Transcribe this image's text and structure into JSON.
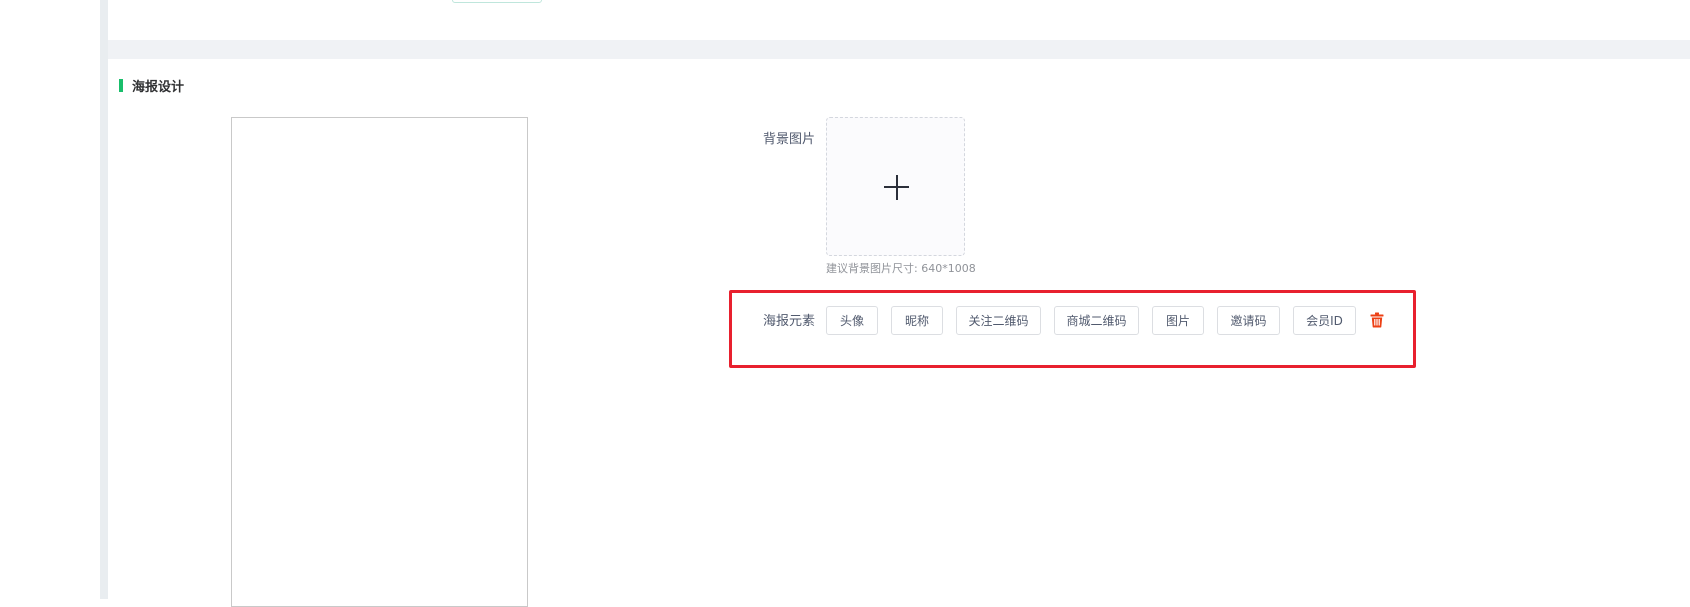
{
  "section": {
    "title": "海报设计"
  },
  "form": {
    "background_label": "背景图片",
    "background_hint": "建议背景图片尺寸: 640*1008",
    "elements_label": "海报元素"
  },
  "elements": [
    {
      "label": "头像"
    },
    {
      "label": "昵称"
    },
    {
      "label": "关注二维码"
    },
    {
      "label": "商城二维码"
    },
    {
      "label": "图片"
    },
    {
      "label": "邀请码"
    },
    {
      "label": "会员ID"
    }
  ],
  "icons": {
    "upload": "plus-icon",
    "delete": "trash-icon"
  },
  "colors": {
    "accent": "#19be6b",
    "highlight": "#e8202e",
    "delete": "#ed4014"
  }
}
